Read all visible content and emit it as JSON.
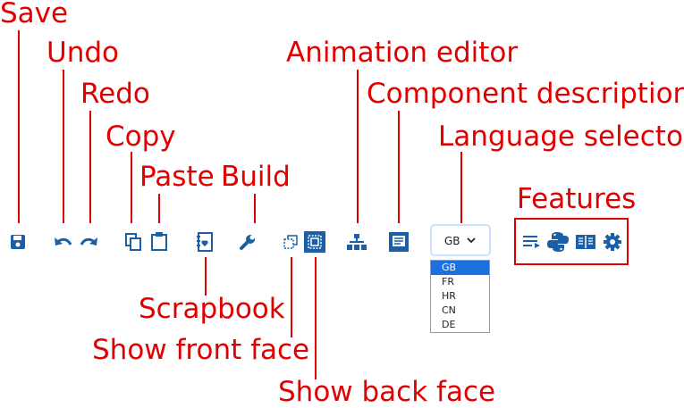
{
  "labels": {
    "save": "Save",
    "undo": "Undo",
    "redo": "Redo",
    "copy": "Copy",
    "paste": "Paste",
    "build": "Build",
    "animation_editor": "Animation editor",
    "component_descriptions": "Component descriptions",
    "language_selector": "Language selector",
    "features": "Features",
    "scrapbook": "Scrapbook",
    "show_front_face": "Show front  face",
    "show_back_face": "Show back face"
  },
  "language": {
    "selected": "GB",
    "options": [
      "GB",
      "FR",
      "HR",
      "CN",
      "DE"
    ]
  },
  "colors": {
    "icon_blue": "#1a5fa8",
    "annotation_red": "#e00000",
    "selected_option": "#1e6fe0"
  },
  "icons": [
    "save-icon",
    "undo-icon",
    "redo-icon",
    "copy-icon",
    "paste-icon",
    "scrapbook-icon",
    "build-icon",
    "show-front-face-icon",
    "show-back-face-icon",
    "animation-editor-icon",
    "component-descriptions-icon",
    "features-list-icon",
    "python-icon",
    "book-icon",
    "settings-gear-icon"
  ]
}
